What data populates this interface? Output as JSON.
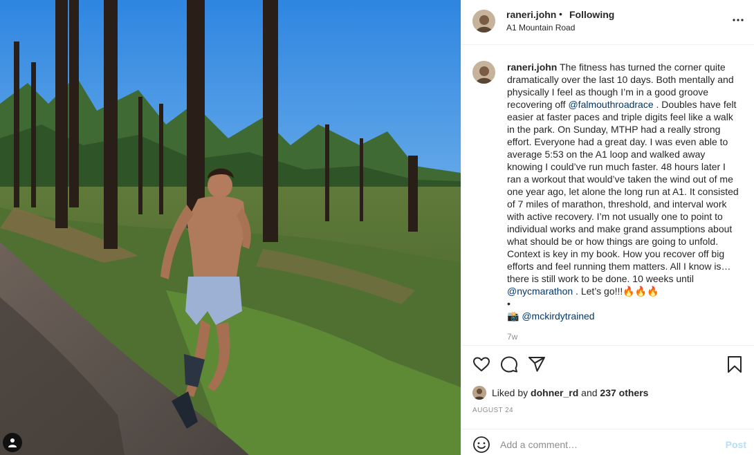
{
  "post": {
    "username": "raneri.john",
    "separator": "•",
    "follow_status": "Following",
    "location": "A1 Mountain Road",
    "caption_lines": [
      "The fitness has turned the corner quite",
      "dramatically over the last 10 days. Both mentally and",
      "physically I feel as though I’m in a good groove",
      "recovering off",
      "@falmouthroadrace",
      ". Doubles have felt",
      "easier at faster paces and triple digits feel like a walk",
      "in the park. On Sunday, MTHP had a really strong",
      "effort. Everyone had a great day. I was even able to",
      "average 5:53 on the A1 loop and walked away",
      "knowing I could’ve run much faster. 48 hours later I",
      "ran a workout that would’ve taken the wind out of me",
      "one year ago, let alone the long run at A1. It consisted",
      "of 7 miles of marathon, threshold, and interval work",
      "with active recovery. I’m not usually one to point to",
      "individual works and make grand assumptions about",
      "what should be or how things are going to unfold.",
      "Context is key in my book. How you recover off big",
      "efforts and feel running them matters. All I know is…",
      "there is still work to be done. 10 weeks until",
      "@nycmarathon",
      ". Let’s go!!!🔥🔥🔥",
      "•",
      "📸",
      "@mckirdytrained"
    ],
    "time_ago": "7w",
    "likes": {
      "prefix": "Liked by",
      "user": "dohner_rd",
      "connector": "and",
      "others": "237 others"
    },
    "date": "AUGUST 24"
  },
  "comment": {
    "placeholder": "Add a comment…",
    "post_label": "Post"
  },
  "icons": {
    "more": "more-options-icon",
    "like": "heart-icon",
    "comment": "comment-icon",
    "share": "paper-plane-icon",
    "save": "bookmark-icon",
    "emoji": "smiley-icon",
    "tag": "user-tag-icon"
  },
  "colors": {
    "text": "#262626",
    "secondary": "#8e8e8e",
    "mention": "#00376b",
    "post_disabled": "#b2dffc",
    "border": "#efefef"
  }
}
